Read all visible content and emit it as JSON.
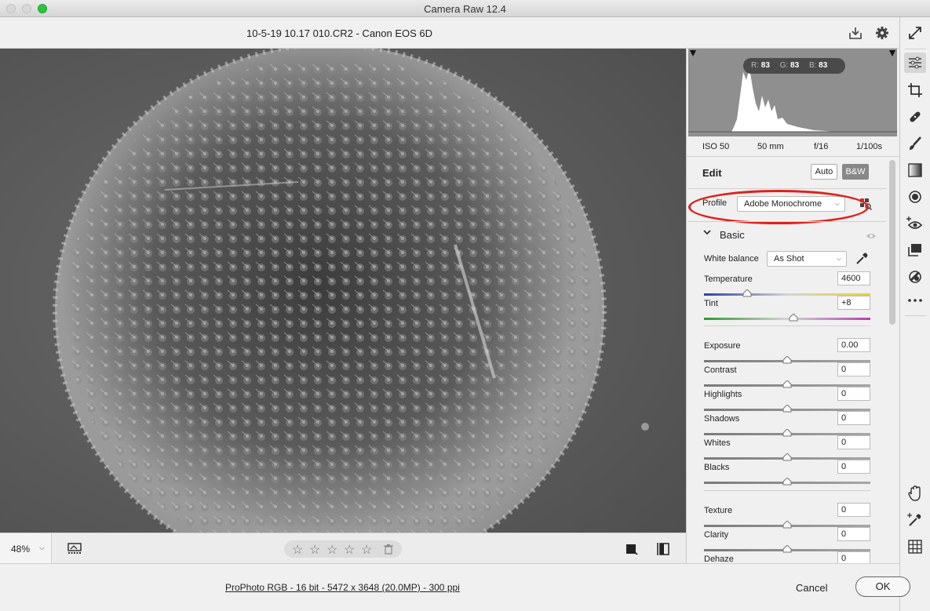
{
  "window": {
    "title": "Camera Raw 12.4"
  },
  "header": {
    "file_title": "10-5-19 10.17 010.CR2  -  Canon EOS 6D"
  },
  "histogram": {
    "r_label": "R:",
    "r_value": "83",
    "g_label": "G:",
    "g_value": "83",
    "b_label": "B:",
    "b_value": "83"
  },
  "camera_info": {
    "iso": "ISO 50",
    "focal": "50 mm",
    "aperture": "f/16",
    "shutter": "1/100s"
  },
  "edit": {
    "label": "Edit",
    "auto_label": "Auto",
    "bw_label": "B&W"
  },
  "profile": {
    "label": "Profile",
    "value": "Adobe Monochrome"
  },
  "basic": {
    "title": "Basic",
    "white_balance_label": "White balance",
    "white_balance_value": "As Shot",
    "sliders": [
      {
        "label": "Temperature",
        "value": "4600",
        "position": 0.26
      },
      {
        "label": "Tint",
        "value": "+8",
        "position": 0.54
      },
      {
        "label": "Exposure",
        "value": "0.00",
        "position": 0.5
      },
      {
        "label": "Contrast",
        "value": "0",
        "position": 0.5
      },
      {
        "label": "Highlights",
        "value": "0",
        "position": 0.5
      },
      {
        "label": "Shadows",
        "value": "0",
        "position": 0.5
      },
      {
        "label": "Whites",
        "value": "0",
        "position": 0.5
      },
      {
        "label": "Blacks",
        "value": "0",
        "position": 0.5
      },
      {
        "label": "Texture",
        "value": "0",
        "position": 0.5
      },
      {
        "label": "Clarity",
        "value": "0",
        "position": 0.5
      },
      {
        "label": "Dehaze",
        "value": "0",
        "position": 0.5
      }
    ]
  },
  "bottom": {
    "zoom": "48%",
    "rating_stars": 5
  },
  "footer": {
    "workflow": "ProPhoto RGB - 16 bit - 5472 x 3648 (20.0MP) - 300 ppi",
    "cancel_label": "Cancel",
    "ok_label": "OK"
  },
  "colors": {
    "accent_red": "#e0201a",
    "image_bg": "#5b5b5b",
    "histogram_bg": "#8f8f8f"
  }
}
